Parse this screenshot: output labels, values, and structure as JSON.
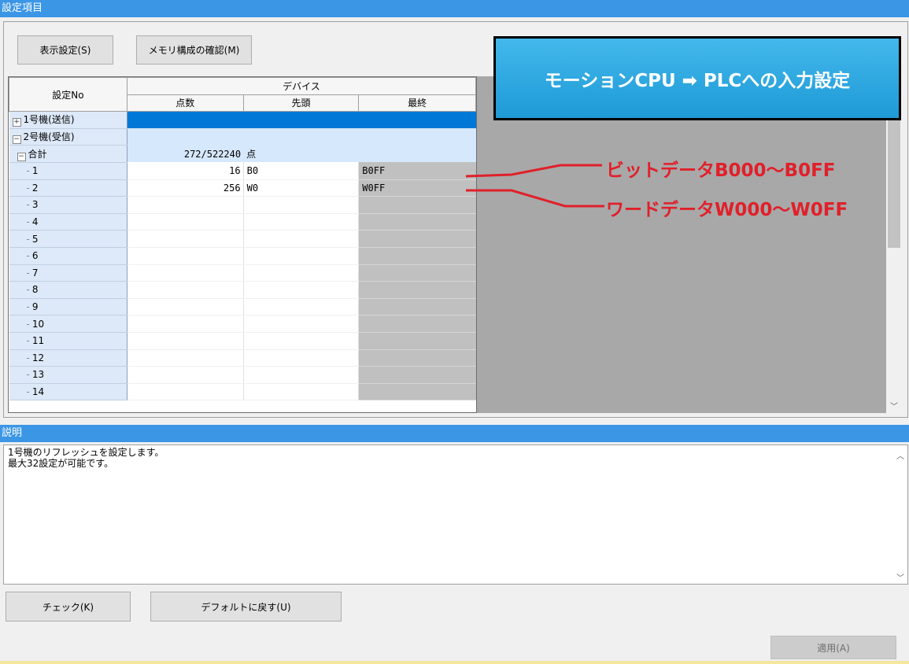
{
  "window": {
    "title": "設定項目"
  },
  "toolbar": {
    "display_settings": "表示設定(S)",
    "memory_check": "メモリ構成の確認(M)"
  },
  "table": {
    "header": {
      "setting_no": "設定No",
      "device": "デバイス",
      "points": "点数",
      "start": "先頭",
      "end": "最終"
    },
    "groups": [
      {
        "label": "1号機(送信)",
        "expand": "+"
      },
      {
        "label": "2号機(受信)",
        "expand": "−"
      }
    ],
    "total": {
      "label": "合計",
      "expand": "−",
      "points": "272/522240",
      "unit": "点"
    },
    "rows": [
      {
        "no": "1",
        "points": "16",
        "start": "B0",
        "end": "B0FF"
      },
      {
        "no": "2",
        "points": "256",
        "start": "W0",
        "end": "W0FF"
      },
      {
        "no": "3",
        "points": "",
        "start": "",
        "end": ""
      },
      {
        "no": "4",
        "points": "",
        "start": "",
        "end": ""
      },
      {
        "no": "5",
        "points": "",
        "start": "",
        "end": ""
      },
      {
        "no": "6",
        "points": "",
        "start": "",
        "end": ""
      },
      {
        "no": "7",
        "points": "",
        "start": "",
        "end": ""
      },
      {
        "no": "8",
        "points": "",
        "start": "",
        "end": ""
      },
      {
        "no": "9",
        "points": "",
        "start": "",
        "end": ""
      },
      {
        "no": "10",
        "points": "",
        "start": "",
        "end": ""
      },
      {
        "no": "11",
        "points": "",
        "start": "",
        "end": ""
      },
      {
        "no": "12",
        "points": "",
        "start": "",
        "end": ""
      },
      {
        "no": "13",
        "points": "",
        "start": "",
        "end": ""
      },
      {
        "no": "14",
        "points": "",
        "start": "",
        "end": ""
      }
    ]
  },
  "annotations": {
    "callout": "モーションCPU ➡ PLCへの入力設定",
    "bit": "ビットデータB000～B0FF",
    "word": "ワードデータW000～W0FF",
    "color": "#e0202a"
  },
  "description": {
    "title": "説明",
    "line1": "1号機のリフレッシュを設定します。",
    "line2": "最大32設定が可能です。"
  },
  "buttons": {
    "check": "チェック(K)",
    "default": "デフォルトに戻す(U)",
    "apply": "適用(A)"
  }
}
